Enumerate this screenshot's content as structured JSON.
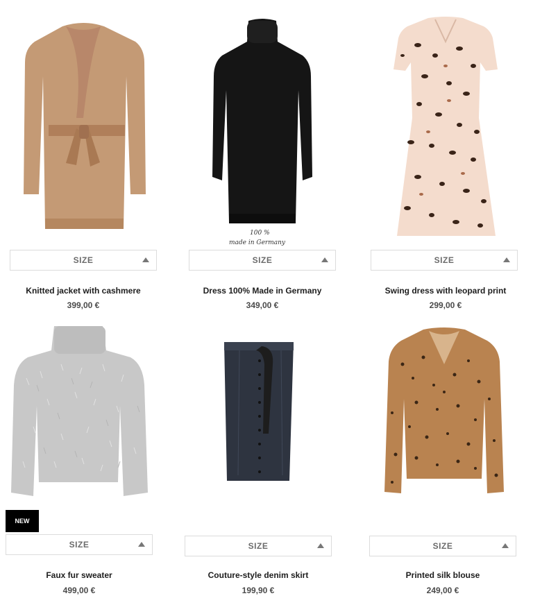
{
  "products": [
    {
      "name": "Knitted jacket with cashmere",
      "price": "399,00 €",
      "size_label": "SIZE"
    },
    {
      "name": "Dress 100% Made in Germany",
      "price": "349,00 €",
      "size_label": "SIZE",
      "tag_line1": "100 %",
      "tag_line2": "made in Germany"
    },
    {
      "name": "Swing dress with leopard print",
      "price": "299,00 €",
      "size_label": "SIZE"
    },
    {
      "name": "Faux fur sweater",
      "price": "499,00 €",
      "size_label": "SIZE",
      "badge": "NEW"
    },
    {
      "name": "Couture-style denim skirt",
      "price": "199,90 €",
      "size_label": "SIZE"
    },
    {
      "name": "Printed silk blouse",
      "price": "249,00 €",
      "size_label": "SIZE"
    }
  ],
  "colors": {
    "camel": "#c49a75",
    "black": "#151515",
    "blush": "#f4dccd",
    "grey": "#c8c8c8",
    "denim": "#2e3440",
    "leopard": "#b98350"
  }
}
